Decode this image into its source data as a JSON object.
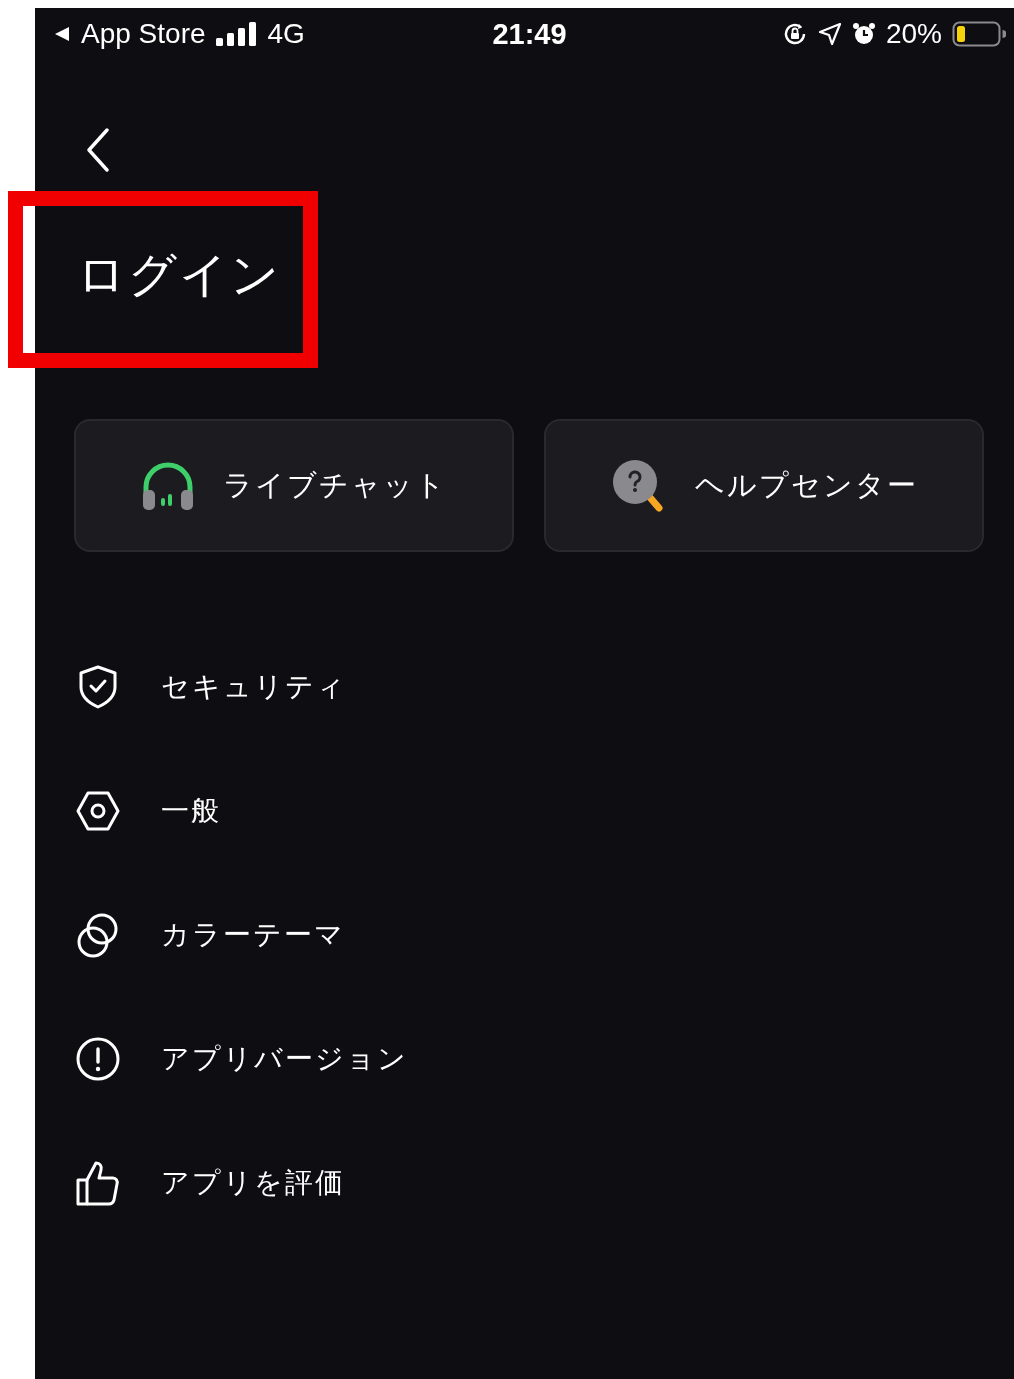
{
  "status_bar": {
    "back_app": "App Store",
    "network": "4G",
    "time": "21:49",
    "battery": "20%"
  },
  "header": {
    "title": "ログイン",
    "title_highlighted": true
  },
  "quick_actions": [
    {
      "kind": "headset",
      "label": "ライブチャット"
    },
    {
      "kind": "help",
      "label": "ヘルプセンター"
    }
  ],
  "menu": [
    {
      "kind": "shield",
      "label": "セキュリティ"
    },
    {
      "kind": "hexagon",
      "label": "一般"
    },
    {
      "kind": "circles",
      "label": "カラーテーマ"
    },
    {
      "kind": "info",
      "label": "アプリバージョン"
    },
    {
      "kind": "thumb",
      "label": "アプリを評価"
    }
  ]
}
